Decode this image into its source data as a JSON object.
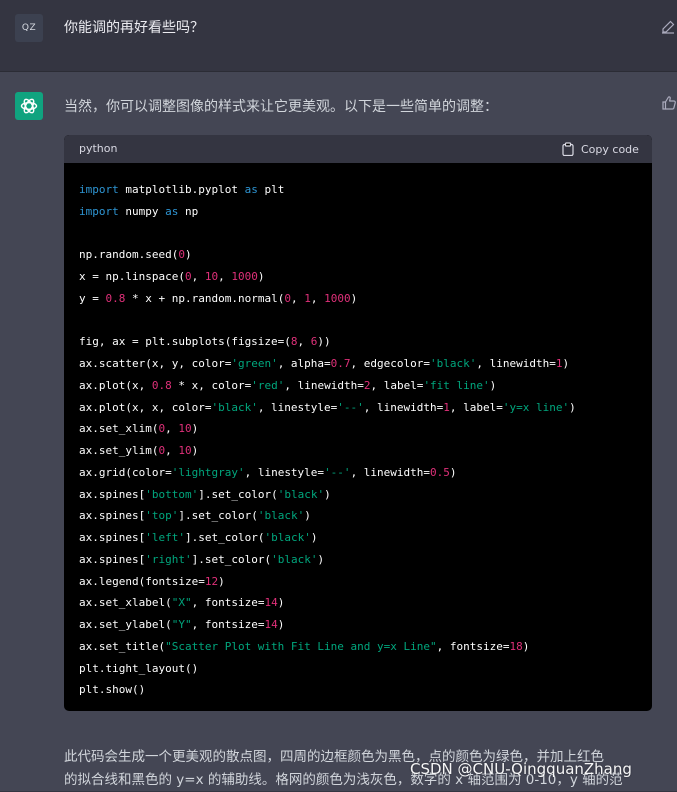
{
  "user_message": {
    "avatar_initials": "QZ",
    "text": "你能调的再好看些吗？"
  },
  "assistant_message": {
    "intro": "当然，你可以调整图像的样式来让它更美观。以下是一些简单的调整：",
    "code_block": {
      "language": "python",
      "copy_label": "Copy code",
      "lines": [
        [
          [
            "kw",
            "import"
          ],
          [
            "p",
            " matplotlib.pyplot "
          ],
          [
            "kw",
            "as"
          ],
          [
            "p",
            " plt"
          ]
        ],
        [
          [
            "kw",
            "import"
          ],
          [
            "p",
            " numpy "
          ],
          [
            "kw",
            "as"
          ],
          [
            "p",
            " np"
          ]
        ],
        [],
        [
          [
            "p",
            "np.random.seed("
          ],
          [
            "num",
            "0"
          ],
          [
            "p",
            ")"
          ]
        ],
        [
          [
            "p",
            "x = np.linspace("
          ],
          [
            "num",
            "0"
          ],
          [
            "p",
            ", "
          ],
          [
            "num",
            "10"
          ],
          [
            "p",
            ", "
          ],
          [
            "num",
            "1000"
          ],
          [
            "p",
            ")"
          ]
        ],
        [
          [
            "p",
            "y = "
          ],
          [
            "num",
            "0.8"
          ],
          [
            "p",
            " * x + np.random.normal("
          ],
          [
            "num",
            "0"
          ],
          [
            "p",
            ", "
          ],
          [
            "num",
            "1"
          ],
          [
            "p",
            ", "
          ],
          [
            "num",
            "1000"
          ],
          [
            "p",
            ")"
          ]
        ],
        [],
        [
          [
            "p",
            "fig, ax = plt.subplots(figsize=("
          ],
          [
            "num",
            "8"
          ],
          [
            "p",
            ", "
          ],
          [
            "num",
            "6"
          ],
          [
            "p",
            "))"
          ]
        ],
        [
          [
            "p",
            "ax.scatter(x, y, color="
          ],
          [
            "str",
            "'green'"
          ],
          [
            "p",
            ", alpha="
          ],
          [
            "num",
            "0.7"
          ],
          [
            "p",
            ", edgecolor="
          ],
          [
            "str",
            "'black'"
          ],
          [
            "p",
            ", linewidth="
          ],
          [
            "num",
            "1"
          ],
          [
            "p",
            ")"
          ]
        ],
        [
          [
            "p",
            "ax.plot(x, "
          ],
          [
            "num",
            "0.8"
          ],
          [
            "p",
            " * x, color="
          ],
          [
            "str",
            "'red'"
          ],
          [
            "p",
            ", linewidth="
          ],
          [
            "num",
            "2"
          ],
          [
            "p",
            ", label="
          ],
          [
            "str",
            "'fit line'"
          ],
          [
            "p",
            ")"
          ]
        ],
        [
          [
            "p",
            "ax.plot(x, x, color="
          ],
          [
            "str",
            "'black'"
          ],
          [
            "p",
            ", linestyle="
          ],
          [
            "str",
            "'--'"
          ],
          [
            "p",
            ", linewidth="
          ],
          [
            "num",
            "1"
          ],
          [
            "p",
            ", label="
          ],
          [
            "str",
            "'y=x line'"
          ],
          [
            "p",
            ")"
          ]
        ],
        [
          [
            "p",
            "ax.set_xlim("
          ],
          [
            "num",
            "0"
          ],
          [
            "p",
            ", "
          ],
          [
            "num",
            "10"
          ],
          [
            "p",
            ")"
          ]
        ],
        [
          [
            "p",
            "ax.set_ylim("
          ],
          [
            "num",
            "0"
          ],
          [
            "p",
            ", "
          ],
          [
            "num",
            "10"
          ],
          [
            "p",
            ")"
          ]
        ],
        [
          [
            "p",
            "ax.grid(color="
          ],
          [
            "str",
            "'lightgray'"
          ],
          [
            "p",
            ", linestyle="
          ],
          [
            "str",
            "'--'"
          ],
          [
            "p",
            ", linewidth="
          ],
          [
            "num",
            "0.5"
          ],
          [
            "p",
            ")"
          ]
        ],
        [
          [
            "p",
            "ax.spines["
          ],
          [
            "str",
            "'bottom'"
          ],
          [
            "p",
            "].set_color("
          ],
          [
            "str",
            "'black'"
          ],
          [
            "p",
            ")"
          ]
        ],
        [
          [
            "p",
            "ax.spines["
          ],
          [
            "str",
            "'top'"
          ],
          [
            "p",
            "].set_color("
          ],
          [
            "str",
            "'black'"
          ],
          [
            "p",
            ")"
          ]
        ],
        [
          [
            "p",
            "ax.spines["
          ],
          [
            "str",
            "'left'"
          ],
          [
            "p",
            "].set_color("
          ],
          [
            "str",
            "'black'"
          ],
          [
            "p",
            ")"
          ]
        ],
        [
          [
            "p",
            "ax.spines["
          ],
          [
            "str",
            "'right'"
          ],
          [
            "p",
            "].set_color("
          ],
          [
            "str",
            "'black'"
          ],
          [
            "p",
            ")"
          ]
        ],
        [
          [
            "p",
            "ax.legend(fontsize="
          ],
          [
            "num",
            "12"
          ],
          [
            "p",
            ")"
          ]
        ],
        [
          [
            "p",
            "ax.set_xlabel("
          ],
          [
            "str",
            "\"X\""
          ],
          [
            "p",
            ", fontsize="
          ],
          [
            "num",
            "14"
          ],
          [
            "p",
            ")"
          ]
        ],
        [
          [
            "p",
            "ax.set_ylabel("
          ],
          [
            "str",
            "\"Y\""
          ],
          [
            "p",
            ", fontsize="
          ],
          [
            "num",
            "14"
          ],
          [
            "p",
            ")"
          ]
        ],
        [
          [
            "p",
            "ax.set_title("
          ],
          [
            "str",
            "\"Scatter Plot with Fit Line and y=x Line\""
          ],
          [
            "p",
            ", fontsize="
          ],
          [
            "num",
            "18"
          ],
          [
            "p",
            ")"
          ]
        ],
        [
          [
            "p",
            "plt.tight_layout()"
          ]
        ],
        [
          [
            "p",
            "plt.show()"
          ]
        ]
      ]
    },
    "description_line1": "此代码会生成一个更美观的散点图，四周的边框颜色为黑色，点的颜色为绿色，并加上红色",
    "description_line2": "的拟合线和黑色的 y=x 的辅助线。格网的颜色为浅灰色，数字的 x 轴范围为 0-10，y 轴的范"
  },
  "watermark": "CSDN @CNU-QingquanZhang",
  "colors": {
    "page_bg": "#343541",
    "assistant_bg": "#444654",
    "code_bg": "#000000",
    "code_header_bg": "#343541",
    "keyword": "#2e95d3",
    "number": "#df3079",
    "string": "#00a67d",
    "gpt_brand": "#10a37f"
  },
  "icons": {
    "edit": "edit-icon",
    "thumbs_up": "thumbs-up-icon",
    "clipboard": "clipboard-icon",
    "gpt_logo": "openai-logo-icon"
  }
}
